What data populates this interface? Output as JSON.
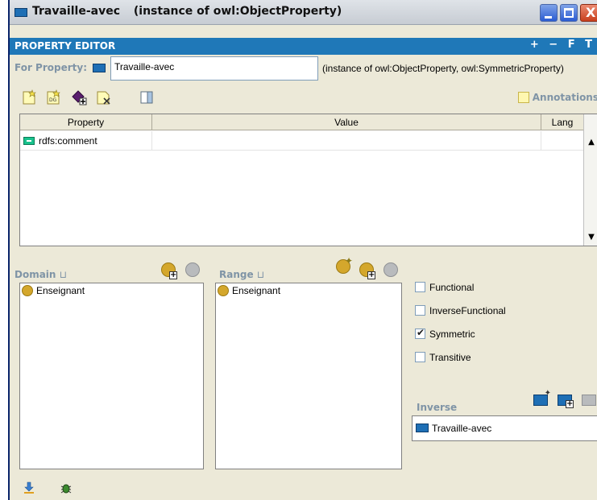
{
  "window": {
    "title": "Travaille-avec",
    "title_suffix": "(instance of owl:ObjectProperty)",
    "close_glyph": "X"
  },
  "header": {
    "label": "PROPERTY EDITOR",
    "tools": "+ − F T"
  },
  "for_property": {
    "label": "For Property:",
    "value": "Travaille-avec",
    "instance_text": "(instance of owl:ObjectProperty, owl:SymmetricProperty)"
  },
  "toolbar": {
    "annotations_label": "Annotations"
  },
  "annotations_table": {
    "columns": [
      "Property",
      "Value",
      "Lang"
    ],
    "rows": [
      {
        "property": "rdfs:comment",
        "value": "",
        "lang": ""
      }
    ]
  },
  "domain": {
    "label": "Domain",
    "items": [
      "Enseignant"
    ]
  },
  "range": {
    "label": "Range",
    "items": [
      "Enseignant"
    ]
  },
  "characteristics": [
    {
      "label": "Functional",
      "checked": false
    },
    {
      "label": "InverseFunctional",
      "checked": false
    },
    {
      "label": "Symmetric",
      "checked": true
    },
    {
      "label": "Transitive",
      "checked": false
    }
  ],
  "inverse": {
    "label": "Inverse",
    "items": [
      "Travaille-avec"
    ]
  },
  "colors": {
    "header_strip": "#1f78b8",
    "section_label": "#7f94a6",
    "class_gold": "#d4a72c",
    "property_blue": "#1e6fb5"
  }
}
